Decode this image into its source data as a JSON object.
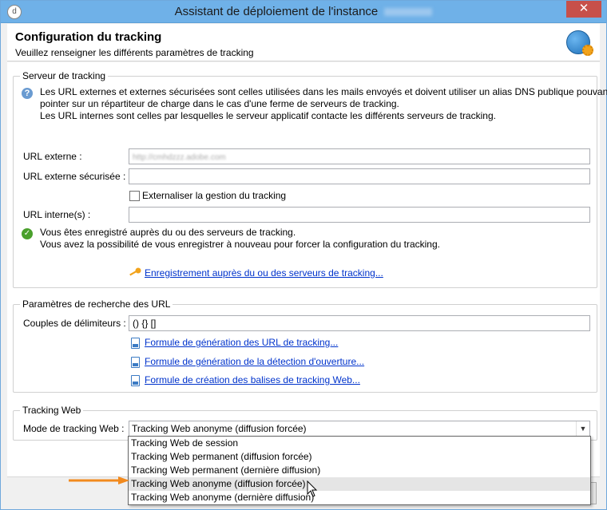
{
  "window": {
    "title": "Assistant de déploiement de l'instance",
    "title_suffix_blurred": "Français",
    "close_glyph": "✕"
  },
  "header": {
    "title": "Configuration du tracking",
    "subtitle": "Veuillez renseigner les différents paramètres de tracking"
  },
  "tracking_server": {
    "legend": "Serveur de tracking",
    "info_line1": "Les URL externes et externes sécurisées sont celles utilisées dans les mails envoyés et doivent utiliser un alias DNS publique pouvant",
    "info_line2": "pointer sur un répartiteur de charge dans le cas d'une ferme de serveurs de tracking.",
    "info_line3": "Les URL internes sont celles par lesquelles le serveur applicatif contacte les différents serveurs de tracking.",
    "external_url_label": "URL externe :",
    "external_url_value": "http://cmhdzzz.adobe.com",
    "secure_url_label": "URL externe sécurisée :",
    "secure_url_value": "",
    "externalize_label": "Externaliser la gestion du tracking",
    "externalize_checked": false,
    "internal_url_label": "URL interne(s) :",
    "internal_url_value": "",
    "status_line1": "Vous êtes enregistré auprès du ou des serveurs de tracking.",
    "status_line2": "Vous avez la possibilité de vous enregistrer à nouveau pour forcer la configuration du tracking.",
    "register_link": "Enregistrement auprès du ou des serveurs de tracking..."
  },
  "url_search": {
    "legend": "Paramètres de recherche des URL",
    "delimiters_label": "Couples de délimiteurs :",
    "delimiters_value": "() {} []",
    "link1": "Formule de génération des URL de tracking...",
    "link2": "Formule de génération de la détection d'ouverture...",
    "link3": "Formule de création des balises de tracking Web..."
  },
  "web_tracking": {
    "legend": "Tracking Web",
    "mode_label": "Mode de tracking Web :",
    "mode_value": "Tracking Web anonyme (diffusion forcée)",
    "options": [
      "Tracking Web de session",
      "Tracking Web permanent (diffusion forcée)",
      "Tracking Web permanent (dernière diffusion)",
      "Tracking Web anonyme (diffusion forcée)",
      "Tracking Web anonyme (dernière diffusion)"
    ],
    "hovered_index": 3
  },
  "colors": {
    "titlebar": "#6fb1e8",
    "link": "#0033cc",
    "arrow": "#f28a1e",
    "ok": "#4aa02c",
    "info": "#6a9bd1"
  },
  "icons": {
    "info": "question-info-icon",
    "ok": "checkmark-icon",
    "key": "key-icon",
    "doc": "document-icon",
    "globe": "globe-gear-icon"
  }
}
